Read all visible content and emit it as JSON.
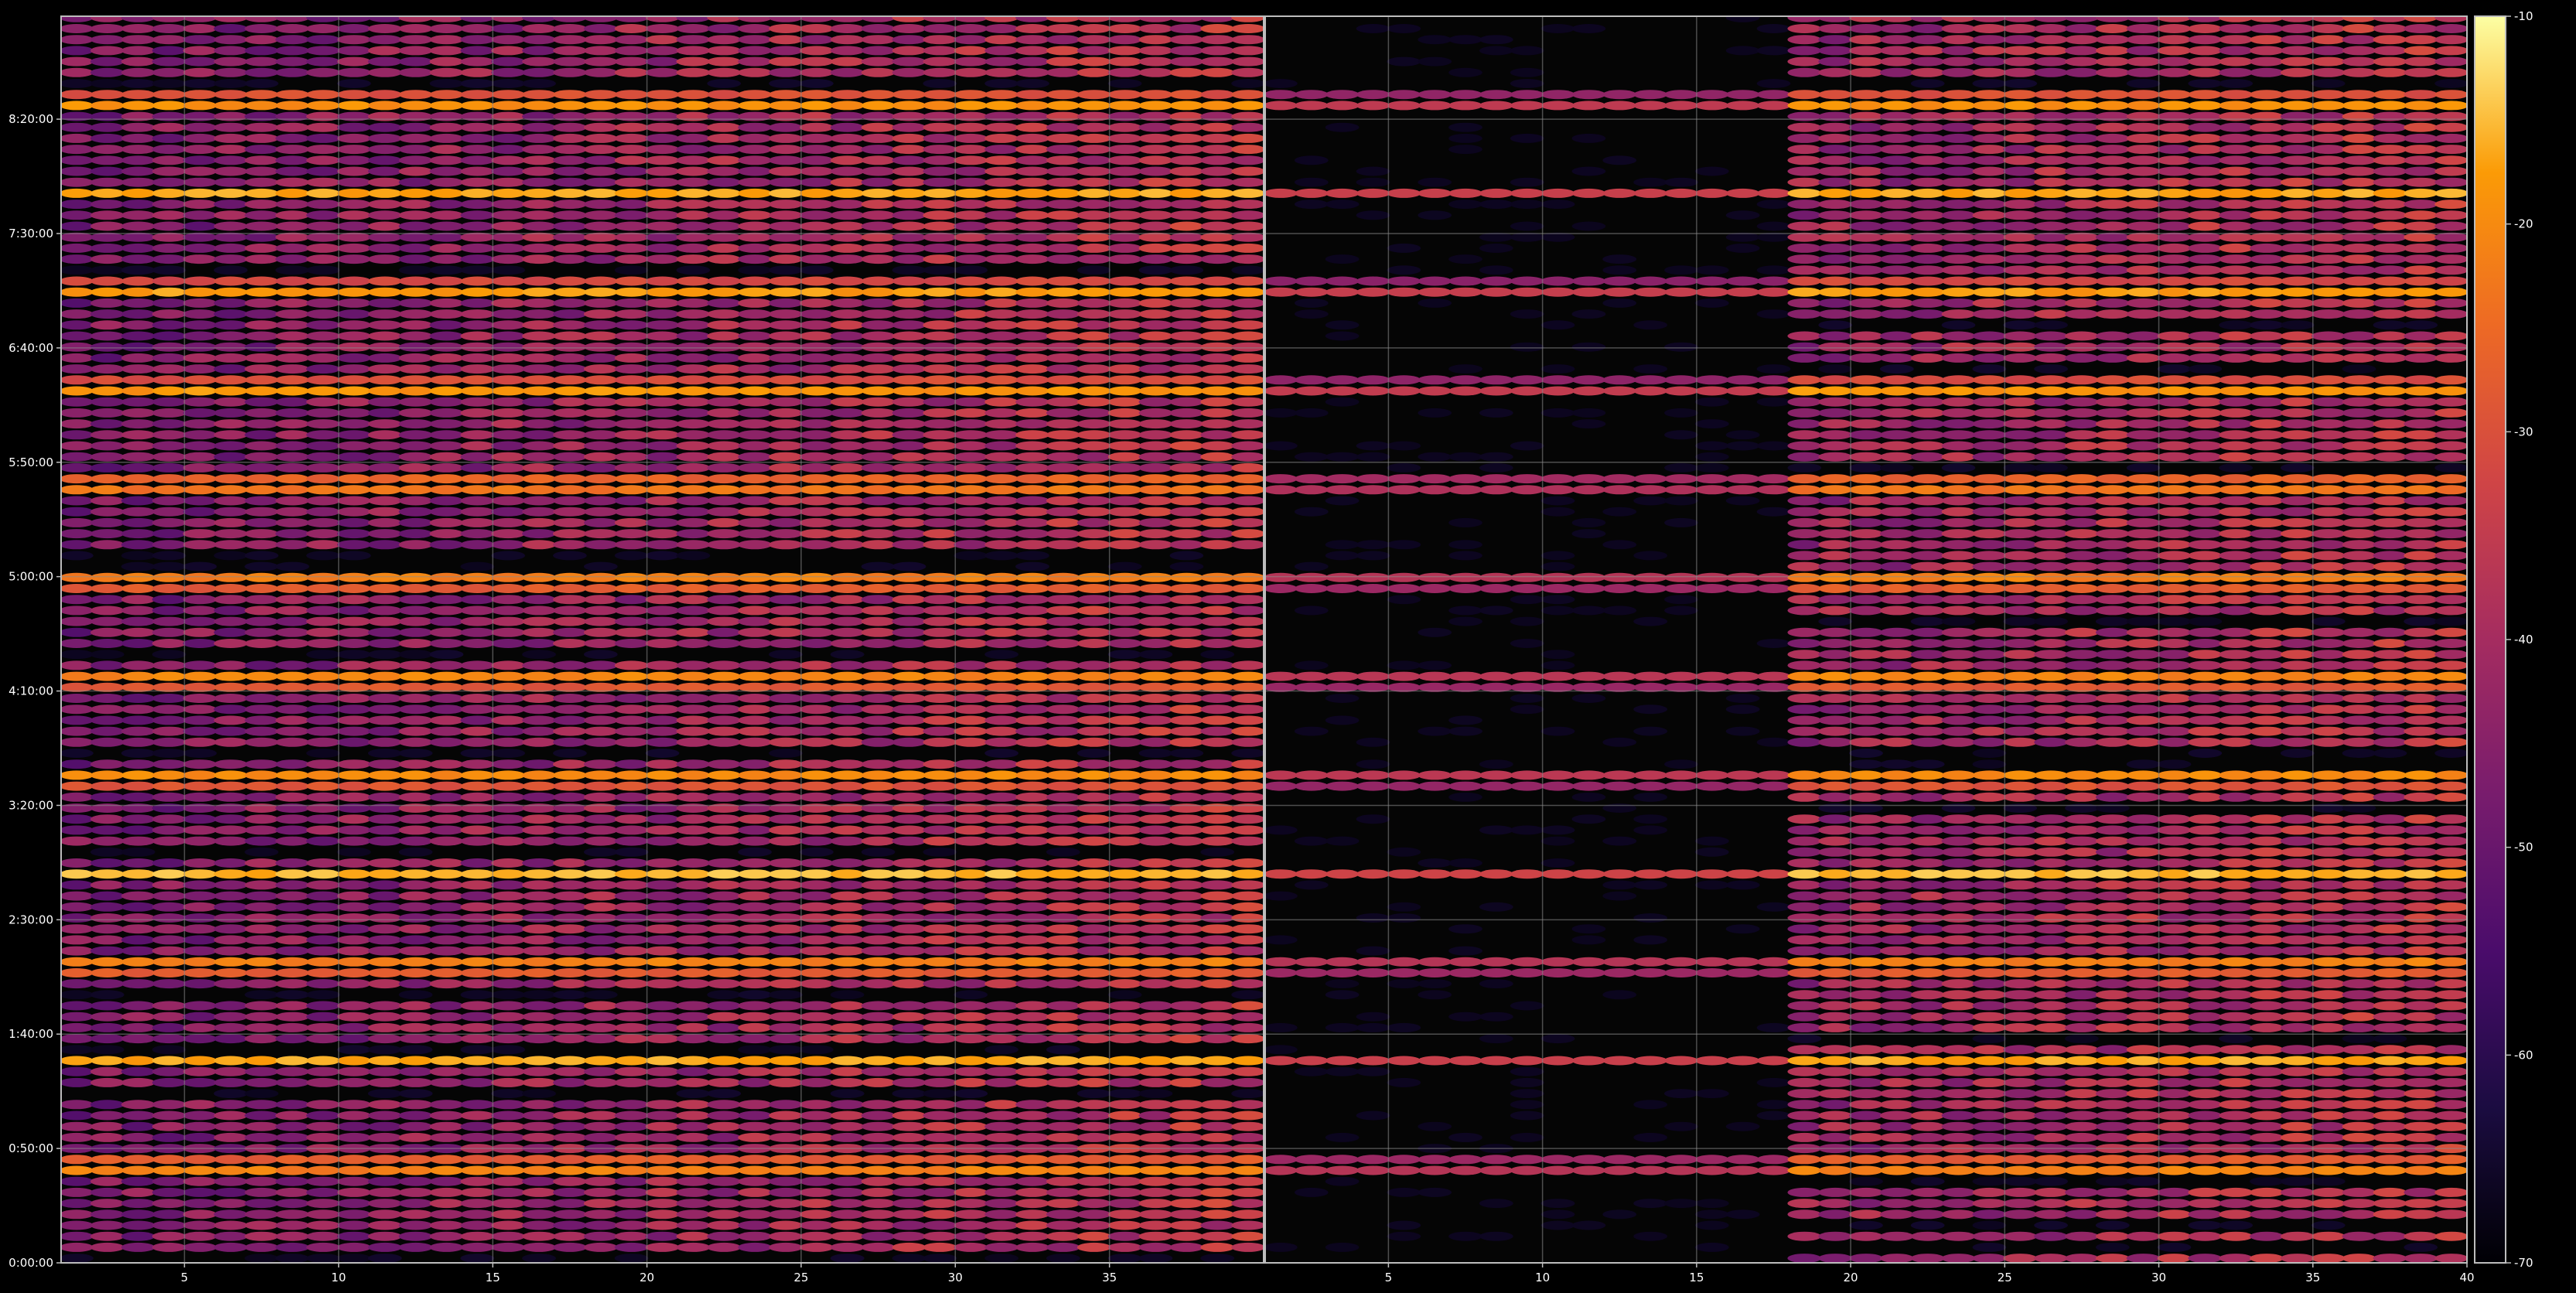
{
  "chart_data": {
    "type": "heatmap",
    "title": "",
    "xlabel": "",
    "ylabel": "",
    "grid": true,
    "colormap": "inferno",
    "colors": {
      "background": "#000000",
      "frame": "#bdbdbd",
      "text": "#ffffff",
      "grid": "#8a8a8a"
    },
    "panels": [
      {
        "name": "",
        "xlim": [
          1,
          40
        ],
        "x_ticks": [
          5,
          10,
          15,
          20,
          25,
          30,
          35
        ],
        "x_tick_labels": [
          "5",
          "10",
          "15",
          "20",
          "25",
          "30",
          "35"
        ]
      },
      {
        "name": "",
        "xlim": [
          1,
          40
        ],
        "x_ticks": [
          5,
          10,
          15,
          20,
          25,
          30,
          35,
          40
        ],
        "x_tick_labels": [
          "5",
          "10",
          "15",
          "20",
          "25",
          "30",
          "35",
          "40"
        ],
        "activity_onset_x": 18,
        "quiet_level": 0.06
      }
    ],
    "y_axis": {
      "label": "",
      "lim_minutes": [
        0,
        545
      ],
      "tick_minutes": [
        0,
        50,
        100,
        150,
        200,
        250,
        300,
        350,
        400,
        450,
        500
      ],
      "tick_labels": [
        "0:00:00",
        "0:50:00",
        "1:40:00",
        "2:30:00",
        "3:20:00",
        "4:10:00",
        "5:00:00",
        "5:50:00",
        "6:40:00",
        "7:30:00",
        "8:20:00"
      ],
      "y_bottom_label": "0:00:00",
      "row_count": 114,
      "row_height_minutes": 4.8
    },
    "colorbar": {
      "min": -70,
      "max": -10,
      "ticks": [
        -70,
        -60,
        -50,
        -40,
        -30,
        -20,
        -10
      ],
      "tick_labels": [
        "-70",
        "-60",
        "-50",
        "-40",
        "-30",
        "-20",
        "-10"
      ]
    },
    "strong_band_minutes": [
      42,
      88,
      130,
      170,
      212,
      255,
      298,
      340,
      382,
      425,
      468,
      507
    ],
    "value_range": [
      -70,
      -10
    ]
  }
}
